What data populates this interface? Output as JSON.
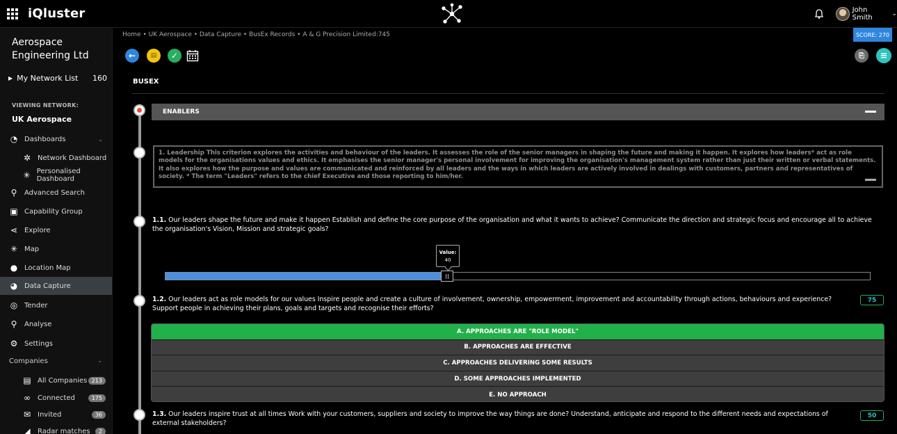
{
  "app": {
    "brand": "iQluster"
  },
  "user": {
    "name": "John Smith"
  },
  "sidebar": {
    "org_name": "Aerospace Engineering Ltd",
    "my_network_label": "My Network List",
    "my_network_count": "160",
    "viewing_label": "VIEWING NETWORK:",
    "viewing_network": "UK Aerospace",
    "items": [
      {
        "label": "Dashboards",
        "icon": "gauge-icon"
      },
      {
        "label": "Network Dashboard",
        "icon": "network-dashboard-icon"
      },
      {
        "label": "Personalised Dashboard",
        "icon": "personalised-dashboard-icon"
      },
      {
        "label": "Advanced Search",
        "icon": "search-icon"
      },
      {
        "label": "Capability Group",
        "icon": "capability-group-icon"
      },
      {
        "label": "Explore",
        "icon": "share-icon"
      },
      {
        "label": "Map",
        "icon": "map-icon"
      },
      {
        "label": "Location Map",
        "icon": "location-pin-icon"
      },
      {
        "label": "Data Capture",
        "icon": "data-capture-icon"
      },
      {
        "label": "Tender",
        "icon": "tender-icon"
      },
      {
        "label": "Analyse",
        "icon": "analyse-icon"
      },
      {
        "label": "Settings",
        "icon": "gear-icon"
      }
    ],
    "companies_label": "Companies",
    "companies": [
      {
        "label": "All Companies",
        "count": "213",
        "icon": "companies-icon"
      },
      {
        "label": "Connected",
        "count": "175",
        "icon": "link-icon"
      },
      {
        "label": "Invited",
        "count": "36",
        "icon": "envelope-icon"
      },
      {
        "label": "Radar matches",
        "count": "2",
        "icon": "radar-icon"
      }
    ]
  },
  "breadcrumb": "Home • UK Aerospace • Data Capture • BusEx Records • A & G Precision Limited:745",
  "score": "SCORE: 270",
  "page": {
    "title": "BUSEX",
    "section": "ENABLERS",
    "criterion": "1.   Leadership This criterion explores the activities and behaviour of the leaders. It assesses the role of the senior managers in shaping the future and making it happen. It explores how leaders* act as role models for the organisations values and ethics. It emphasises the senior manager's personal involvement for improving the organisation's management system rather than just their written or verbal statements. It also explores how the purpose and values are communicated and reinforced by all leaders and the ways in which leaders are actively involved in dealings with customers, partners and representatives of society. * The term \"Leaders\" refers to the chief Executive and those reporting to him/her.",
    "questions": [
      {
        "num": "1.1.",
        "text": "Our leaders shape the future and make it happen Establish and define the core purpose of the organisation and what it wants to achieve? Communicate the direction and strategic focus and encourage all to achieve the organisation's Vision, Mission and strategic goals?"
      },
      {
        "num": "1.2.",
        "text": "Our leaders act as role models for our values Inspire people and create a culture of involvement, ownership, empowerment, improvement and accountability through actions, behaviours and experience? Support people in achieving their plans, goals and targets and recognise their efforts?",
        "value": "75"
      },
      {
        "num": "1.3.",
        "text": "Our leaders inspire trust at all times Work with your customers, suppliers and society to improve the way things are done? Understand, anticipate and respond to the different needs and expectations of external stakeholders?",
        "value": "50"
      }
    ],
    "slider": {
      "label": "Value:",
      "value": "40",
      "fraction": 0.4
    },
    "options": [
      "A. APPROACHES ARE \"ROLE MODEL\"",
      "B. APPROACHES ARE EFFECTIVE",
      "C. APPROACHES DELIVERING SOME RESULTS",
      "D. SOME APPROACHES IMPLEMENTED",
      "E. NO APPROACH"
    ],
    "selected_option": 0
  },
  "colors": {
    "accent": "#2e86de",
    "selected": "#22b04b",
    "active_nav": "#3a3f44"
  }
}
